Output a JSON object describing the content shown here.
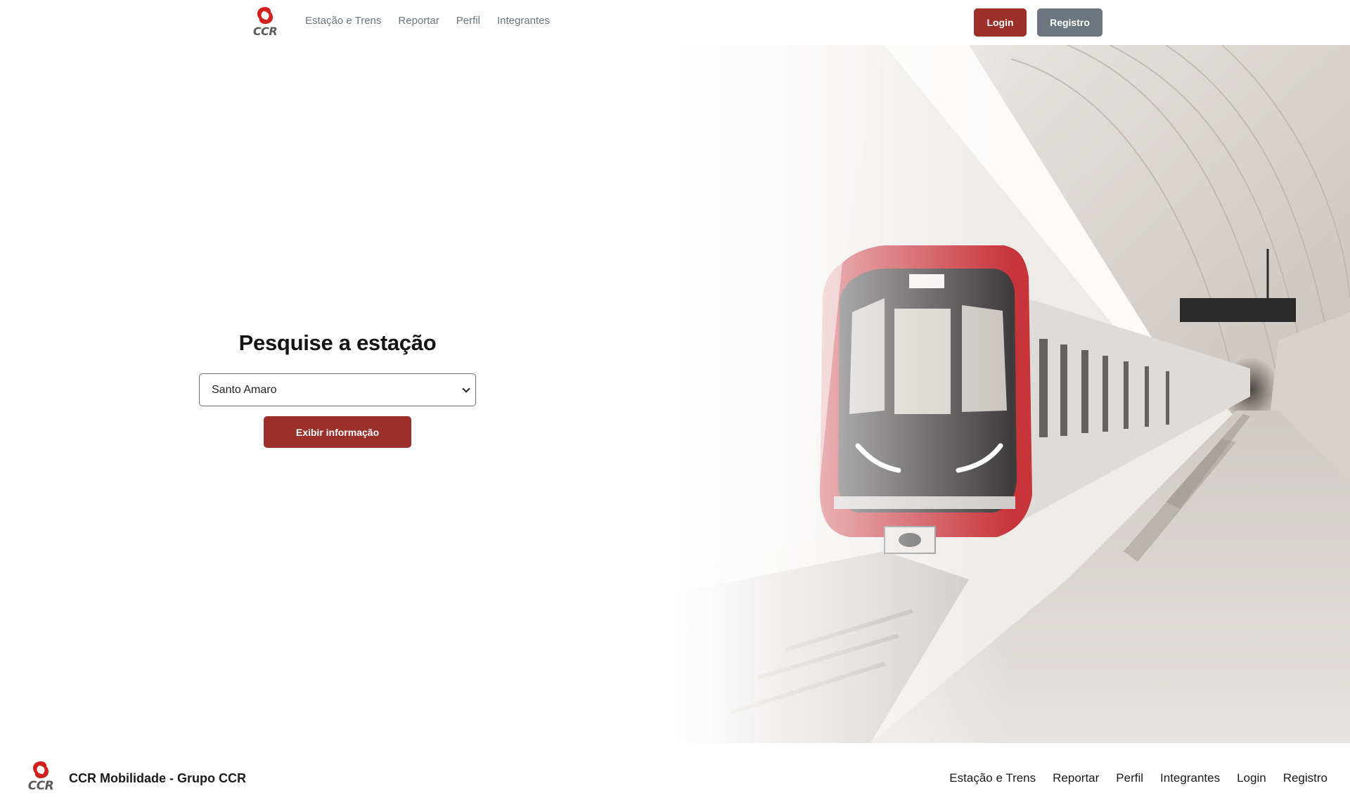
{
  "brand": {
    "logo_text": "CCR",
    "accent_color": "#9b2f2a",
    "secondary_color": "#6c757d"
  },
  "header": {
    "nav": [
      "Estação e Trens",
      "Reportar",
      "Perfil",
      "Integrantes"
    ],
    "login_label": "Login",
    "registro_label": "Registro"
  },
  "search": {
    "title": "Pesquise a estação",
    "selected_station": "Santo Amaro",
    "button_label": "Exibir informação"
  },
  "hero": {
    "image": "subway-train-at-station"
  },
  "footer": {
    "logo_text": "CCR",
    "brand": "CCR Mobilidade - Grupo CCR",
    "links": [
      "Estação e Trens",
      "Reportar",
      "Perfil",
      "Integrantes",
      "Login",
      "Registro"
    ]
  }
}
